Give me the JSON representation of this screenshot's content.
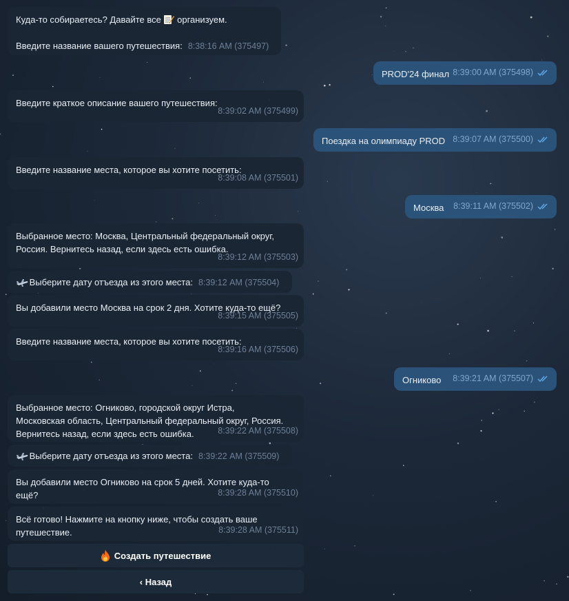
{
  "chat": {
    "messages": [
      {
        "text_a": "Куда-то собираетесь? Давайте все",
        "text_b": "организуем.",
        "text_c": "Введите название вашего путешествия:",
        "meta": "8:38:16 AM (375497)"
      },
      {
        "text": "PROD'24 финал",
        "meta": "8:39:00 AM (375498)"
      },
      {
        "text": "Введите краткое описание вашего путешествия:",
        "meta": "8:39:02 AM (375499)"
      },
      {
        "text": "Поездка на олимпиаду PROD",
        "meta": "8:39:07 AM (375500)"
      },
      {
        "text": "Введите название места, которое вы хотите посетить:",
        "meta": "8:39:08 AM (375501)"
      },
      {
        "text": "Москва",
        "meta": "8:39:11 AM (375502)"
      },
      {
        "text": "Выбранное место: Москва, Центральный федеральный округ,\nРоссия. Вернитесь назад, если здесь есть ошибка.",
        "meta": "8:39:12 AM (375503)"
      },
      {
        "text": "Выберите дату отъезда из этого места:",
        "meta": "8:39:12 AM (375504)"
      },
      {
        "text": "Вы добавили место Москва на срок 2 дня. Хотите куда-то ещё?",
        "meta": "8:39:15 AM (375505)"
      },
      {
        "text": "Введите название места, которое вы хотите посетить:",
        "meta": "8:39:16 AM (375506)"
      },
      {
        "text": "Огниково",
        "meta": "8:39:21 AM (375507)"
      },
      {
        "text": "Выбранное место: Огниково, городской округ Истра,\nМосковская область, Центральный федеральный округ, Россия.\nВернитесь назад, если здесь есть ошибка.",
        "meta": "8:39:22 AM (375508)"
      },
      {
        "text": "Выберите дату отъезда из этого места:",
        "meta": "8:39:22 AM (375509)"
      },
      {
        "text": "Вы добавили место Огниково на срок 5 дней. Хотите куда-то\nещё?",
        "meta": "8:39:28 AM (375510)"
      },
      {
        "text": "Всё готово! Нажмите на кнопку ниже, чтобы создать ваше\nпутешествие.",
        "meta": "8:39:28 AM (375511)"
      }
    ]
  },
  "keyboard": {
    "create_label": "Создать путешествие",
    "back_label": "‹ Назад"
  },
  "icons": {
    "memo": "memo-icon",
    "airplane": "airplane-icon",
    "fire": "fire-icon",
    "read": "double-check-icon"
  },
  "colors": {
    "incoming_bubble": "#1b2635",
    "outgoing_bubble": "#2b5278",
    "read_check": "#5fa8e8"
  }
}
